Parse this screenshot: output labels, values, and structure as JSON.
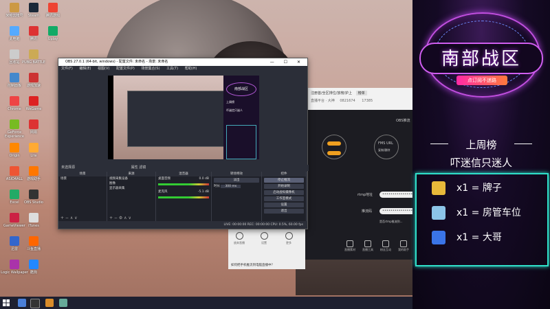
{
  "desktop": {
    "icons": [
      {
        "label": "米哈云帐号",
        "color": "#c94"
      },
      {
        "label": "Steam",
        "color": "#1b2838"
      },
      {
        "label": "腾讯游戏",
        "color": "#e43"
      },
      {
        "label": "此电脑",
        "color": "#5af"
      },
      {
        "label": "腾讯",
        "color": "#d33"
      },
      {
        "label": "Uplay",
        "color": "#1a6"
      },
      {
        "label": "回收站",
        "color": "#ccc"
      },
      {
        "label": "PUBG BATTLE",
        "color": "#ca5"
      },
      {
        "label": "",
        "color": ""
      },
      {
        "label": "控制面板",
        "color": "#48c"
      },
      {
        "label": "游戏加速",
        "color": "#c33"
      },
      {
        "label": "",
        "color": ""
      },
      {
        "label": "Chrome",
        "color": "#e44"
      },
      {
        "label": "WeGame",
        "color": "#d22"
      },
      {
        "label": "",
        "color": ""
      },
      {
        "label": "GeForce Experience",
        "color": "#7b2"
      },
      {
        "label": "网易",
        "color": "#d33"
      },
      {
        "label": "",
        "color": ""
      },
      {
        "label": "Origin",
        "color": "#f80"
      },
      {
        "label": "Lite",
        "color": "#fa3"
      },
      {
        "label": "",
        "color": ""
      },
      {
        "label": "ASIO4ALL",
        "color": "#e53"
      },
      {
        "label": "游戏助手",
        "color": "#f70"
      },
      {
        "label": "",
        "color": ""
      },
      {
        "label": "Excel",
        "color": "#2a6"
      },
      {
        "label": "OBS Studio",
        "color": "#333"
      },
      {
        "label": "",
        "color": ""
      },
      {
        "label": "GameViewer",
        "color": "#c24"
      },
      {
        "label": "iTunes",
        "color": "#ddd"
      },
      {
        "label": "",
        "color": ""
      },
      {
        "label": "迅雷",
        "color": "#36c"
      },
      {
        "label": "斗鱼直播",
        "color": "#f60"
      },
      {
        "label": "",
        "color": ""
      },
      {
        "label": "Logic Wallpaper",
        "color": "#a3a"
      },
      {
        "label": "酷狗",
        "color": "#28f"
      },
      {
        "label": "",
        "color": ""
      }
    ]
  },
  "obs": {
    "title": "OBS 27.0.1 (64-bit, windows) - 配置文件: 未命名 - 场景: 未命名",
    "controls": "— ☐ ✕",
    "menu": [
      "文件(F)",
      "编辑(E)",
      "视图(V)",
      "配置文件(P)",
      "场景集合(S)",
      "工具(T)",
      "帮助(H)"
    ],
    "scene_info": "未选择源",
    "scene_tools": "属性  滤镜",
    "docks": {
      "scenes": {
        "header": "场景",
        "items": [
          "场景"
        ]
      },
      "sources": {
        "header": "来源",
        "items": [
          "视频采集设备",
          "图像",
          "显示器采集"
        ]
      },
      "mixer": {
        "header": "混音器",
        "tracks": [
          {
            "name": "桌面音频",
            "db": "0.0 dB"
          },
          {
            "name": "麦克风",
            "db": "-5.1 dB"
          }
        ]
      },
      "transitions": {
        "header": "转场特效",
        "type": "淡出",
        "duration_label": "时长",
        "duration": "300 ms"
      },
      "controls": {
        "header": "控件",
        "buttons": [
          "停止推流",
          "开始录制",
          "启动虚拟摄像机",
          "工作室模式",
          "设置",
          "退出"
        ]
      }
    },
    "status": "LIVE: 00:00:00   REC: 00:00:00   CPU: 0.5%, 60.00 fps"
  },
  "preview": {
    "panel_title": "南部战区",
    "panel_weekly": "上周榜",
    "panel_sub": "吓迷信只迷人"
  },
  "assistant": {
    "header_text": "注册首/全区排位/放榜/护上",
    "tag": "榜单",
    "sub_text": "直播平台 · 大神",
    "id_number": "0821674",
    "fans": "17385",
    "obs_label": "OBS推流",
    "fms_label": "FMS URL",
    "fms_sub": "复制/删除",
    "rtmp_label": "rtmp地址",
    "code_label": "推流码",
    "rtmp_value": "••••••••••••••••",
    "code_value": "••••••••••••••••",
    "hint": "是否rtmp推流到...",
    "icons": [
      "直播素材",
      "直播工具",
      "粉丝互动",
      "我的助手"
    ],
    "dialog_items": [
      "放弃直播",
      "设置",
      "更多"
    ],
    "dialog_note": "如何把手机推流到电脑直播中？"
  },
  "live_panel": {
    "title": "南部战区",
    "subscribe": "点订阅不迷路",
    "weekly_title": "上周榜",
    "weekly_sub": "吓迷信只迷人",
    "entries": [
      {
        "text": "x1 = 牌子",
        "color": "#e8b93a"
      },
      {
        "text": "x1 = 房管车位",
        "color": "#8cc4e8"
      },
      {
        "text": "x1 = 大哥",
        "color": "#3a74e8"
      }
    ]
  },
  "colors": {
    "accent": "#c24fe0",
    "list_border": "#2fe0c9",
    "obs_bg": "#2b2e38",
    "toggle": "#f0a020"
  }
}
